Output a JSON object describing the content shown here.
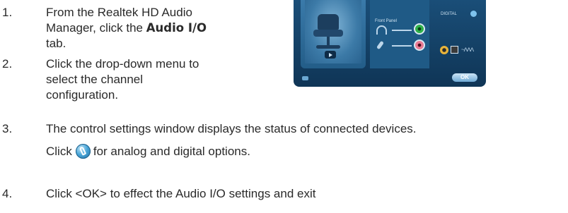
{
  "steps": [
    {
      "number": "1.",
      "lines": [
        "From the Realtek HD Audio",
        "Manager, click the",
        "tab."
      ],
      "bold": "Audio I/O"
    },
    {
      "number": "2.",
      "lines": [
        "Click the drop-down menu to",
        "select the channel",
        "configuration."
      ]
    },
    {
      "number": "3.",
      "lines": [
        "The control settings window displays the status of connected devices.",
        "Click",
        "for analog and digital options."
      ],
      "icon": "help-icon"
    },
    {
      "number": "4.",
      "lines": [
        "Click <OK> to effect the Audio I/O settings and exit"
      ]
    }
  ],
  "panel": {
    "front_panel_label": "Front Panel",
    "digital_label": "DIGITAL",
    "ok_label": "OK",
    "wave_text": "~ᐱᐱᐱ",
    "colors": {
      "background": "#1a4e78",
      "green_jack": "#2fb14a",
      "pink_jack": "#e97a93"
    }
  }
}
